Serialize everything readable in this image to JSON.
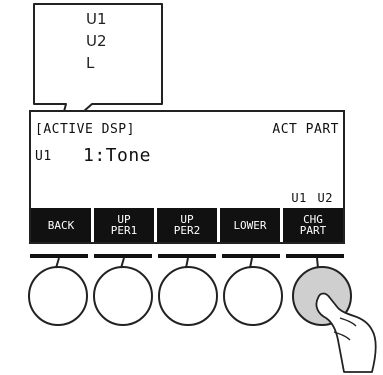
{
  "callout": {
    "lines": [
      "U1",
      "U2",
      "L"
    ]
  },
  "lcd": {
    "header_left": "[ACTIVE DSP]",
    "header_right": "ACT PART",
    "part_label": "U1",
    "value": "1:Tone",
    "indicator": "U1 U2"
  },
  "softkeys": [
    {
      "label": "BACK"
    },
    {
      "label": "UP\nPER1"
    },
    {
      "label": "UP\nPER2"
    },
    {
      "label": "LOWER"
    },
    {
      "label": "CHG\nPART"
    }
  ],
  "pressed_button_index": 4,
  "colors": {
    "lcd_ink": "#111111",
    "pressed_button": "#cfcfcf"
  },
  "icons": [
    "hand-pointer-icon"
  ]
}
